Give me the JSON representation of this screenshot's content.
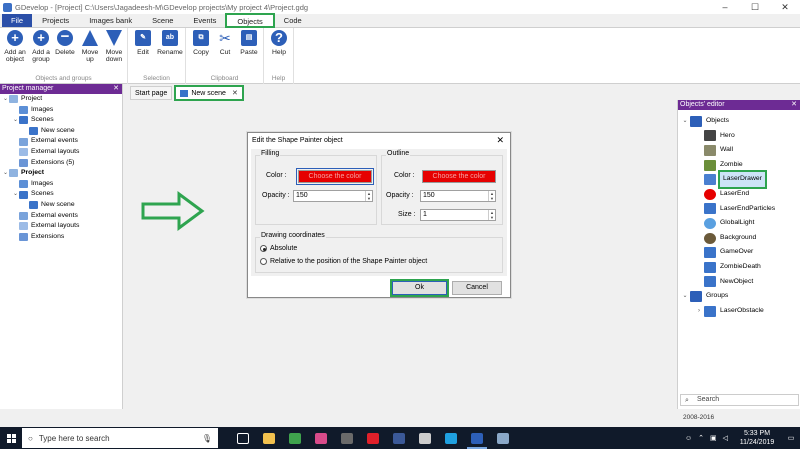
{
  "window": {
    "title": "GDevelop - [Project] C:\\Users\\Jagadeesh-M\\GDevelop projects\\My project 4\\Project.gdg",
    "controls": [
      "–",
      "☐",
      "✕"
    ]
  },
  "ribbon": {
    "tabs": [
      "File",
      "Projects",
      "Images bank",
      "Scene",
      "Events",
      "Objects",
      "Code"
    ],
    "groups": {
      "objects_and_groups": {
        "label": "Objects and groups",
        "buttons": [
          "Add an object",
          "Add a group",
          "Delete",
          "Move up",
          "Move down"
        ]
      },
      "selection": {
        "label": "Selection",
        "buttons": [
          "Edit",
          "Rename"
        ]
      },
      "clipboard": {
        "label": "Clipboard",
        "buttons": [
          "Copy",
          "Cut",
          "Paste"
        ]
      },
      "help": {
        "label": "Help",
        "buttons": [
          "Help"
        ]
      }
    }
  },
  "project_manager": {
    "title": "Project manager",
    "close": "✕",
    "tree": [
      {
        "label": "Project",
        "level": 0,
        "icon": "proj",
        "tw": "⌄"
      },
      {
        "label": "Images",
        "level": 1,
        "icon": "img",
        "tw": ""
      },
      {
        "label": "Scenes",
        "level": 1,
        "icon": "scene",
        "tw": "⌄"
      },
      {
        "label": "New scene",
        "level": 2,
        "icon": "scene",
        "tw": ""
      },
      {
        "label": "External events",
        "level": 1,
        "icon": "ev",
        "tw": ""
      },
      {
        "label": "External layouts",
        "level": 1,
        "icon": "lay",
        "tw": ""
      },
      {
        "label": "Extensions (5)",
        "level": 1,
        "icon": "ext",
        "tw": ""
      },
      {
        "label": "Project",
        "level": 0,
        "icon": "proj",
        "tw": "⌄",
        "bold": true
      },
      {
        "label": "Images",
        "level": 1,
        "icon": "img",
        "tw": ""
      },
      {
        "label": "Scenes",
        "level": 1,
        "icon": "scene",
        "tw": "⌄"
      },
      {
        "label": "New scene",
        "level": 2,
        "icon": "scene",
        "tw": ""
      },
      {
        "label": "External events",
        "level": 1,
        "icon": "ev",
        "tw": ""
      },
      {
        "label": "External layouts",
        "level": 1,
        "icon": "lay",
        "tw": ""
      },
      {
        "label": "Extensions",
        "level": 1,
        "icon": "ext",
        "tw": ""
      }
    ]
  },
  "doc_tabs": {
    "start_page": "Start page",
    "new_scene": "New scene",
    "close": "✕"
  },
  "dialog": {
    "title": "Edit the Shape Painter object",
    "close": "✕",
    "filling": {
      "legend": "Filling",
      "color_label": "Color :",
      "color_button": "Choose the color",
      "opacity_label": "Opacity :",
      "opacity_value": "150"
    },
    "outline": {
      "legend": "Outline",
      "color_label": "Color :",
      "color_button": "Choose the color",
      "opacity_label": "Opacity :",
      "opacity_value": "150",
      "size_label": "Size :",
      "size_value": "1"
    },
    "drawing": {
      "legend": "Drawing coordinates",
      "absolute": "Absolute",
      "relative": "Relative to the position of the Shape Painter object",
      "selected": "absolute"
    },
    "ok": "Ok",
    "cancel": "Cancel"
  },
  "objects_editor": {
    "title": "Objects' editor",
    "close": "✕",
    "items": [
      {
        "label": "Objects",
        "level": 0,
        "tw": "⌄",
        "color": "#2d5fb8"
      },
      {
        "label": "Hero",
        "level": 1,
        "tw": "",
        "color": "#444444"
      },
      {
        "label": "Wall",
        "level": 1,
        "tw": "",
        "color": "#8a8a6a"
      },
      {
        "label": "Zombie",
        "level": 1,
        "tw": "",
        "color": "#6b8f3a"
      },
      {
        "label": "LaserDrawer",
        "level": 1,
        "tw": "",
        "color": "#4a7fd0",
        "selected": true
      },
      {
        "label": "LaserEnd",
        "level": 1,
        "tw": "",
        "color": "#e60000",
        "round": true
      },
      {
        "label": "LaserEndParticles",
        "level": 1,
        "tw": "",
        "color": "#3a73c9"
      },
      {
        "label": "GlobalLight",
        "level": 1,
        "tw": "",
        "color": "#5aa0e0",
        "round": true
      },
      {
        "label": "Background",
        "level": 1,
        "tw": "",
        "color": "#6b5a3a",
        "round": true
      },
      {
        "label": "GameOver",
        "level": 1,
        "tw": "",
        "color": "#3a73c9"
      },
      {
        "label": "ZombieDeath",
        "level": 1,
        "tw": "",
        "color": "#3a73c9"
      },
      {
        "label": "NewObject",
        "level": 1,
        "tw": "",
        "color": "#3a73c9"
      },
      {
        "label": "Groups",
        "level": 0,
        "tw": "⌄",
        "color": "#2d5fb8"
      },
      {
        "label": "LaserObstacle",
        "level": 1,
        "tw": "›",
        "color": "#3a73c9"
      }
    ],
    "search_placeholder": "Search"
  },
  "status_bar": {
    "text": "2008-2016"
  },
  "taskbar": {
    "search_placeholder": "Type here to search",
    "time": "5:33 PM",
    "date": "11/24/2019",
    "icons": [
      {
        "name": "task-view-icon",
        "color": "#ffffff"
      },
      {
        "name": "explorer-icon",
        "color": "#f2c14e"
      },
      {
        "name": "chrome-icon",
        "color": "#3fa34d"
      },
      {
        "name": "media-icon",
        "color": "#d84b8a"
      },
      {
        "name": "app-icon",
        "color": "#6a6a6a"
      },
      {
        "name": "opera-icon",
        "color": "#e0202a"
      },
      {
        "name": "facebook-icon",
        "color": "#3b5998"
      },
      {
        "name": "settings-icon",
        "color": "#cccccc"
      },
      {
        "name": "skype-icon",
        "color": "#1fa0e0"
      },
      {
        "name": "gdevelop-icon",
        "color": "#2d5fb8"
      },
      {
        "name": "steam-icon",
        "color": "#8aa8c8"
      }
    ]
  },
  "colors": {
    "accent_purple": "#6d2b94",
    "highlight_green": "#2ea44f",
    "file_tab_blue": "#2b4fa8",
    "color_swatch_red": "#e60000"
  }
}
